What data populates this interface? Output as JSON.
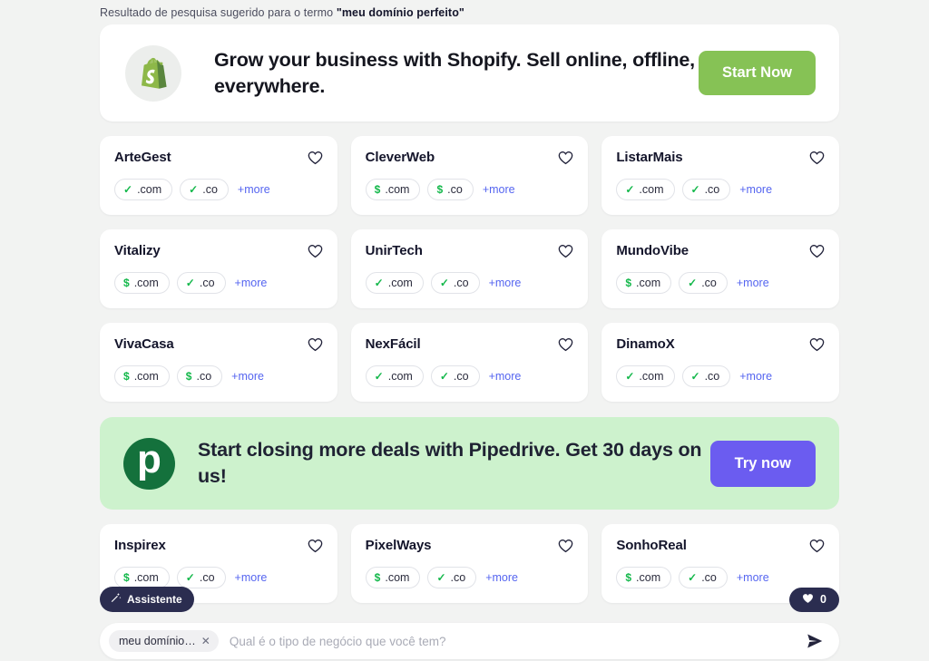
{
  "header": {
    "prefix": "Resultado de pesquisa sugerido para o termo ",
    "term": "\"meu domínio perfeito\""
  },
  "promos": {
    "shopify": {
      "logo_icon": "shopify-bag-icon",
      "text": "Grow your business with Shopify. Sell online, offline, everywhere.",
      "button_label": "Start Now",
      "button_color": "#86c255",
      "background": "#ffffff"
    },
    "pipedrive": {
      "logo_icon": "pipedrive-p-icon",
      "logo_letter": "p",
      "text": "Start closing more deals with Pipedrive. Get 30 days on us!",
      "button_label": "Try now",
      "button_color": "#6b5cf0",
      "background": "#cdf2cd"
    }
  },
  "cards": {
    "more_label": "+more",
    "heart_icon": "heart-outline-icon",
    "check_glyph": "✓",
    "money_glyph": "$",
    "rows": [
      [
        {
          "name": "ArteGest",
          "tlds": [
            {
              "tld": ".com",
              "status": "available"
            },
            {
              "tld": ".co",
              "status": "available"
            }
          ]
        },
        {
          "name": "CleverWeb",
          "tlds": [
            {
              "tld": ".com",
              "status": "premium"
            },
            {
              "tld": ".co",
              "status": "premium"
            }
          ]
        },
        {
          "name": "ListarMais",
          "tlds": [
            {
              "tld": ".com",
              "status": "available"
            },
            {
              "tld": ".co",
              "status": "available"
            }
          ]
        }
      ],
      [
        {
          "name": "Vitalizy",
          "tlds": [
            {
              "tld": ".com",
              "status": "premium"
            },
            {
              "tld": ".co",
              "status": "available"
            }
          ]
        },
        {
          "name": "UnirTech",
          "tlds": [
            {
              "tld": ".com",
              "status": "available"
            },
            {
              "tld": ".co",
              "status": "available"
            }
          ]
        },
        {
          "name": "MundoVibe",
          "tlds": [
            {
              "tld": ".com",
              "status": "premium"
            },
            {
              "tld": ".co",
              "status": "available"
            }
          ]
        }
      ],
      [
        {
          "name": "VivaCasa",
          "tlds": [
            {
              "tld": ".com",
              "status": "premium"
            },
            {
              "tld": ".co",
              "status": "premium"
            }
          ]
        },
        {
          "name": "NexFácil",
          "tlds": [
            {
              "tld": ".com",
              "status": "available"
            },
            {
              "tld": ".co",
              "status": "available"
            }
          ]
        },
        {
          "name": "DinamoX",
          "tlds": [
            {
              "tld": ".com",
              "status": "available"
            },
            {
              "tld": ".co",
              "status": "available"
            }
          ]
        }
      ]
    ],
    "rows_after_promo": [
      [
        {
          "name": "Inspirex",
          "tlds": [
            {
              "tld": ".com",
              "status": "premium"
            },
            {
              "tld": ".co",
              "status": "available"
            }
          ]
        },
        {
          "name": "PixelWays",
          "tlds": [
            {
              "tld": ".com",
              "status": "premium"
            },
            {
              "tld": ".co",
              "status": "available"
            }
          ]
        },
        {
          "name": "SonhoReal",
          "tlds": [
            {
              "tld": ".com",
              "status": "premium"
            },
            {
              "tld": ".co",
              "status": "available"
            }
          ]
        }
      ]
    ]
  },
  "assistant": {
    "pill_label": "Assistente",
    "pill_icon": "magic-wand-icon",
    "favorites_count": "0",
    "favorites_icon": "heart-filled-icon",
    "token_label": "meu domínio…",
    "token_close_icon": "close-icon",
    "input_value": "",
    "input_placeholder": "Qual é o tipo de negócio que você tem?",
    "send_icon": "send-icon"
  }
}
